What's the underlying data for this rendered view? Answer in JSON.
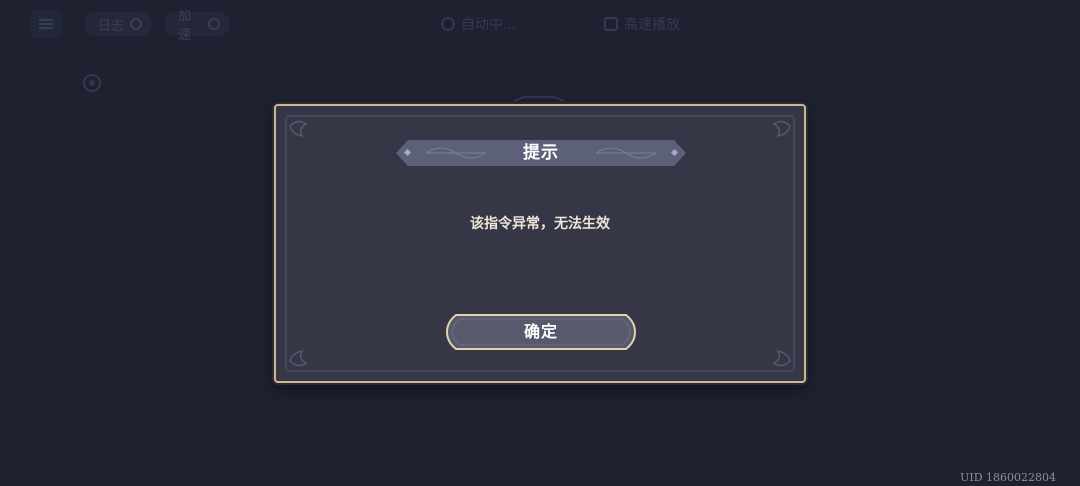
{
  "topbar": {
    "menu_icon": "hamburger-icon",
    "pill_1_label": "日志",
    "pill_2_label": "加速",
    "auto_status": "自动中...",
    "fast_option": "高速播放"
  },
  "dialog": {
    "title": "提示",
    "message": "该指令异常，无法生效",
    "confirm_label": "确定"
  },
  "footer": {
    "uid": "UID 1860022804"
  },
  "colors": {
    "background": "#1e2130",
    "dialog_bg": "#353646",
    "gold_border": "#cdb98c",
    "banner": "#5c6079",
    "button_fill": "#575a6c"
  }
}
